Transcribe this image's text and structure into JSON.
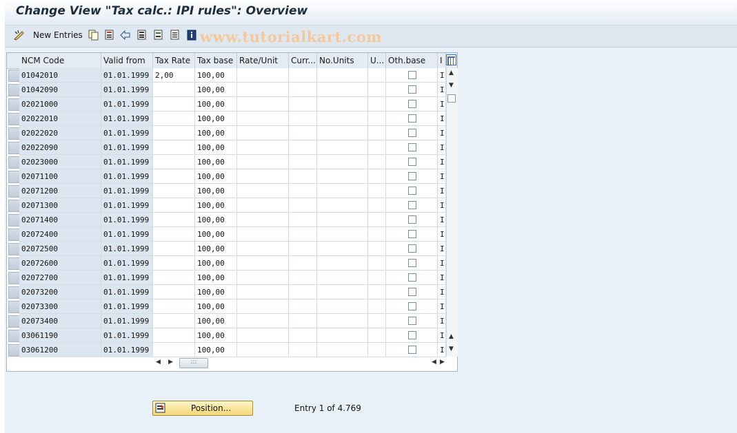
{
  "title": "Change View \"Tax calc.: IPI rules\": Overview",
  "toolbar": {
    "new_entries_label": "New Entries",
    "icons": [
      "new-entries-icon",
      "copy-icon",
      "save-as-icon",
      "undo-icon",
      "select-all-icon",
      "deselect-icon",
      "select-block-icon",
      "info-icon"
    ]
  },
  "watermark": "www.tutorialkart.com",
  "columns": [
    "NCM Code",
    "Valid from",
    "Tax Rate",
    "Tax base",
    "Rate/Unit",
    "Curr...",
    "No.Units",
    "U...",
    "Oth.base",
    "I"
  ],
  "rows": [
    {
      "ncm": "01042010",
      "valid": "01.01.1999",
      "rate": "2,00",
      "base": "100,00",
      "i": "I"
    },
    {
      "ncm": "01042090",
      "valid": "01.01.1999",
      "rate": "",
      "base": "100,00",
      "i": "I"
    },
    {
      "ncm": "02021000",
      "valid": "01.01.1999",
      "rate": "",
      "base": "100,00",
      "i": "I"
    },
    {
      "ncm": "02022010",
      "valid": "01.01.1999",
      "rate": "",
      "base": "100,00",
      "i": "I"
    },
    {
      "ncm": "02022020",
      "valid": "01.01.1999",
      "rate": "",
      "base": "100,00",
      "i": "I"
    },
    {
      "ncm": "02022090",
      "valid": "01.01.1999",
      "rate": "",
      "base": "100,00",
      "i": "I"
    },
    {
      "ncm": "02023000",
      "valid": "01.01.1999",
      "rate": "",
      "base": "100,00",
      "i": "I"
    },
    {
      "ncm": "02071100",
      "valid": "01.01.1999",
      "rate": "",
      "base": "100,00",
      "i": "I"
    },
    {
      "ncm": "02071200",
      "valid": "01.01.1999",
      "rate": "",
      "base": "100,00",
      "i": "I"
    },
    {
      "ncm": "02071300",
      "valid": "01.01.1999",
      "rate": "",
      "base": "100,00",
      "i": "I"
    },
    {
      "ncm": "02071400",
      "valid": "01.01.1999",
      "rate": "",
      "base": "100,00",
      "i": "I"
    },
    {
      "ncm": "02072400",
      "valid": "01.01.1999",
      "rate": "",
      "base": "100,00",
      "i": "I"
    },
    {
      "ncm": "02072500",
      "valid": "01.01.1999",
      "rate": "",
      "base": "100,00",
      "i": "I"
    },
    {
      "ncm": "02072600",
      "valid": "01.01.1999",
      "rate": "",
      "base": "100,00",
      "i": "I"
    },
    {
      "ncm": "02072700",
      "valid": "01.01.1999",
      "rate": "",
      "base": "100,00",
      "i": "I"
    },
    {
      "ncm": "02073200",
      "valid": "01.01.1999",
      "rate": "",
      "base": "100,00",
      "i": "I"
    },
    {
      "ncm": "02073300",
      "valid": "01.01.1999",
      "rate": "",
      "base": "100,00",
      "i": "I"
    },
    {
      "ncm": "02073400",
      "valid": "01.01.1999",
      "rate": "",
      "base": "100,00",
      "i": "I"
    },
    {
      "ncm": "03061190",
      "valid": "01.01.1999",
      "rate": "",
      "base": "100,00",
      "i": "I"
    },
    {
      "ncm": "03061200",
      "valid": "01.01.1999",
      "rate": "",
      "base": "100,00",
      "i": "I"
    }
  ],
  "position_button_label": "Position...",
  "entry_info": "Entry 1 of 4.769",
  "colors": {
    "accent": "#f4d777",
    "key_column": "#dbe6f1",
    "header": "#e4ebf2"
  }
}
